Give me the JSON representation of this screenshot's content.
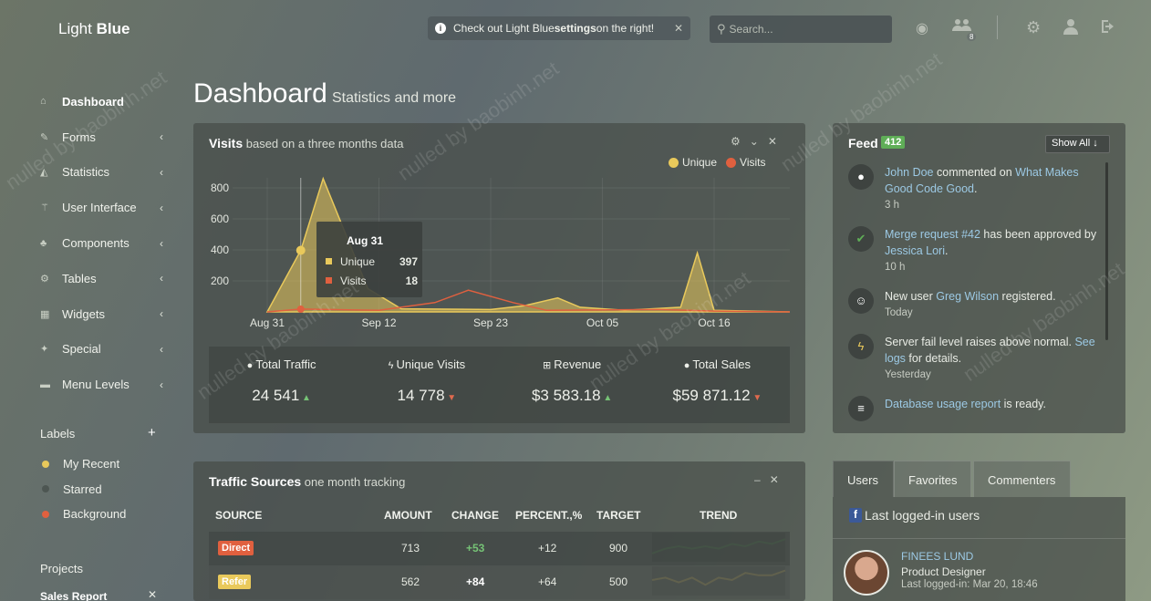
{
  "app": {
    "brand_light": "Light",
    "brand_bold": "Blue"
  },
  "sidebar": {
    "items": [
      {
        "label": "Dashboard",
        "icon": "home-icon",
        "active": true
      },
      {
        "label": "Forms",
        "icon": "pencil-icon"
      },
      {
        "label": "Statistics",
        "icon": "area-chart-icon"
      },
      {
        "label": "User Interface",
        "icon": "magic-wand-icon"
      },
      {
        "label": "Components",
        "icon": "tree-icon"
      },
      {
        "label": "Tables",
        "icon": "gear-icon"
      },
      {
        "label": "Widgets",
        "icon": "grid-icon"
      },
      {
        "label": "Special",
        "icon": "pin-icon"
      },
      {
        "label": "Menu Levels",
        "icon": "folder-icon"
      }
    ],
    "labels_title": "Labels",
    "labels": [
      {
        "name": "My Recent",
        "color": "#e9c95b"
      },
      {
        "name": "Starred",
        "color": "#4d5652"
      },
      {
        "name": "Background",
        "color": "#e0603f"
      }
    ],
    "projects_title": "Projects",
    "sales_report": "Sales Report"
  },
  "topbar": {
    "notice_pre": "Check out Light Blue ",
    "notice_bold": "settings",
    "notice_post": " on the right!",
    "search_placeholder": "Search...",
    "messages_count": "8"
  },
  "page": {
    "title": "Dashboard",
    "subtitle": "Statistics and more"
  },
  "visits": {
    "title": "Visits",
    "subtitle": "based on a three months data",
    "legend": [
      {
        "name": "Unique",
        "color": "#e9c95b"
      },
      {
        "name": "Visits",
        "color": "#e0603f"
      }
    ],
    "tooltip": {
      "date": "Aug 31",
      "unique_label": "Unique",
      "unique_value": "397",
      "visits_label": "Visits",
      "visits_value": "18"
    }
  },
  "chart_data": {
    "type": "area",
    "x": [
      "Aug 31",
      "Sep 12",
      "Sep 23",
      "Oct 05",
      "Oct 16"
    ],
    "yticks": [
      200,
      400,
      600,
      800
    ],
    "ylim": [
      0,
      900
    ],
    "series": [
      {
        "name": "Unique",
        "color": "#e9c95b",
        "points": [
          [
            0,
            0
          ],
          [
            0.3,
            397
          ],
          [
            0.5,
            860
          ],
          [
            0.9,
            150
          ],
          [
            1.2,
            20
          ],
          [
            2,
            15
          ],
          [
            2.3,
            40
          ],
          [
            2.6,
            90
          ],
          [
            2.8,
            30
          ],
          [
            3.2,
            10
          ],
          [
            3.7,
            30
          ],
          [
            3.85,
            380
          ],
          [
            4,
            10
          ],
          [
            4.7,
            0
          ]
        ]
      },
      {
        "name": "Visits",
        "color": "#e0603f",
        "points": [
          [
            0,
            0
          ],
          [
            0.3,
            18
          ],
          [
            1,
            10
          ],
          [
            1.5,
            60
          ],
          [
            1.8,
            140
          ],
          [
            2.2,
            60
          ],
          [
            2.5,
            10
          ],
          [
            3.5,
            15
          ],
          [
            4,
            5
          ],
          [
            4.7,
            0
          ]
        ]
      }
    ]
  },
  "totals": [
    {
      "icon": "users-icon",
      "label": "Total Traffic",
      "value": "24 541",
      "trend": "up"
    },
    {
      "icon": "bolt-icon",
      "label": "Unique Visits",
      "value": "14 778",
      "trend": "down"
    },
    {
      "icon": "plus-square-icon",
      "label": "Revenue",
      "value": "$3 583.18",
      "trend": "up"
    },
    {
      "icon": "user-icon",
      "label": "Total Sales",
      "value": "$59 871.12",
      "trend": "down"
    }
  ],
  "feed": {
    "title": "Feed",
    "count": "412",
    "show_all": "Show All",
    "items": [
      {
        "icon": "comment-icon",
        "a1": "John Doe",
        "t1": " commented on ",
        "a2": "What Makes Good Code Good",
        "t2": ".",
        "time": "3 h"
      },
      {
        "icon": "check-icon",
        "a1": "Merge request #42",
        "t1": " has been approved by ",
        "a2": "Jessica Lori",
        "t2": ".",
        "time": "10 h"
      },
      {
        "icon": "avatar-icon",
        "a1": "",
        "t1": "New user ",
        "a2": "Greg Wilson",
        "t2": " registered.",
        "time": "Today"
      },
      {
        "icon": "bolt-icon",
        "a1": "",
        "t1": "Server fail level raises above normal. ",
        "a2": "See logs",
        "t2": " for details.",
        "time": "Yesterday"
      },
      {
        "icon": "database-icon",
        "a1": "Database usage report",
        "t1": " is ready.",
        "a2": "",
        "t2": "",
        "time": ""
      }
    ]
  },
  "traffic": {
    "title": "Traffic Sources",
    "subtitle": "one month tracking",
    "headers": [
      "SOURCE",
      "AMOUNT",
      "CHANGE",
      "PERCENT.,%",
      "TARGET",
      "TREND"
    ],
    "rows": [
      {
        "source": "Direct",
        "color": "#e0603f",
        "amount": "713",
        "change": "+53",
        "percent": "+12",
        "target": "900",
        "trend_color": "#5fae57",
        "trend": [
          2,
          4,
          5,
          4,
          5,
          4,
          6,
          5,
          7,
          6,
          8
        ]
      },
      {
        "source": "Refer",
        "color": "#e9c95b",
        "amount": "562",
        "change": "+84",
        "percent": "+64",
        "target": "500",
        "trend_color": "#e9c95b",
        "trend": [
          5,
          6,
          4,
          6,
          3,
          6,
          5,
          8,
          7,
          7,
          9
        ]
      }
    ]
  },
  "users": {
    "tabs": [
      "Users",
      "Favorites",
      "Commenters"
    ],
    "heading": "Last logged-in users",
    "user": {
      "name": "FINEES LUND",
      "role": "Product Designer",
      "last": "Last logged-in: Mar 20, 18:46"
    }
  }
}
